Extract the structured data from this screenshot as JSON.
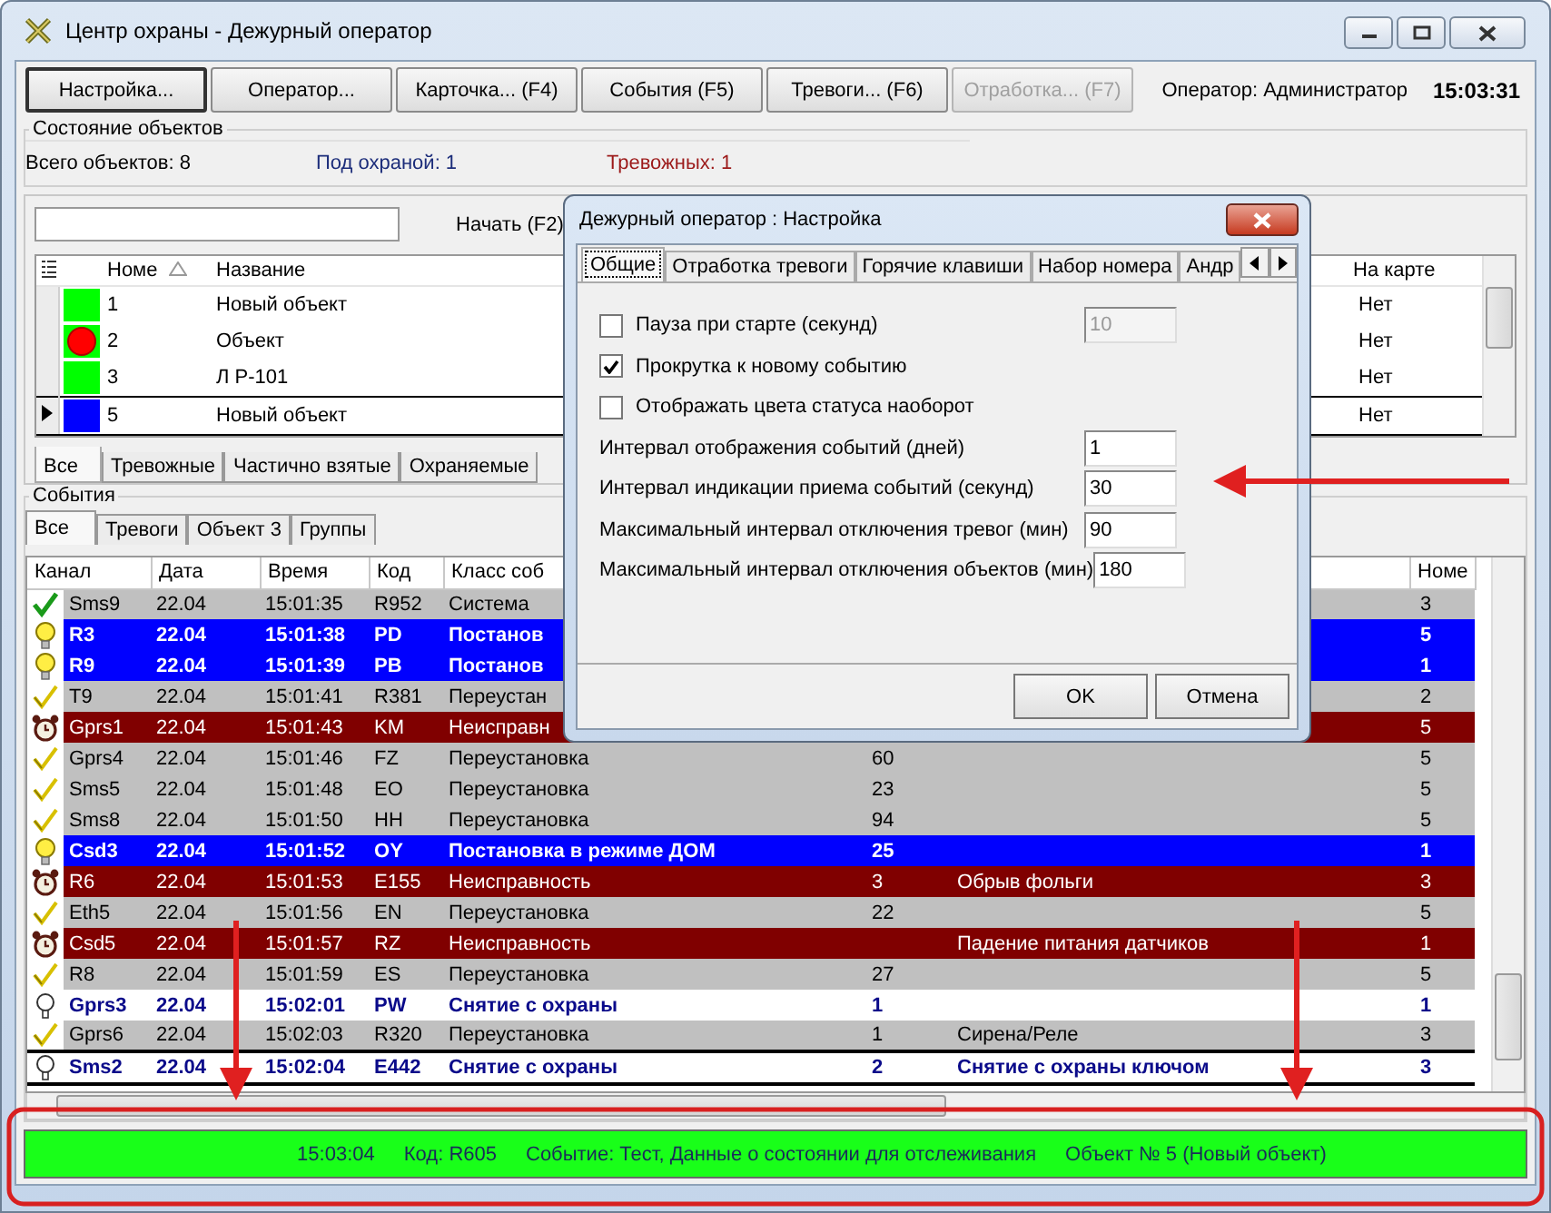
{
  "window": {
    "title": "Центр охраны - Дежурный оператор"
  },
  "toolbar": {
    "buttons": [
      {
        "label": "Настройка...",
        "default": true,
        "disabled": false
      },
      {
        "label": "Оператор...",
        "default": false,
        "disabled": false
      },
      {
        "label": "Карточка... (F4)",
        "default": false,
        "disabled": false
      },
      {
        "label": "События (F5)",
        "default": false,
        "disabled": false
      },
      {
        "label": "Тревоги... (F6)",
        "default": false,
        "disabled": false
      },
      {
        "label": "Отработка... (F7)",
        "default": false,
        "disabled": true
      }
    ],
    "operator": "Оператор: Администратор",
    "clock": "15:03:31"
  },
  "objects_state": {
    "title": "Состояние объектов",
    "counters": [
      {
        "kind": "total",
        "text": "Всего объектов: 8"
      },
      {
        "kind": "armed",
        "text": "Под охраной: 1"
      },
      {
        "kind": "alarm",
        "text": "Тревожных: 1"
      }
    ]
  },
  "objects": {
    "search_button": "Начать (F2)",
    "table": {
      "columns": [
        "Номе",
        "Название",
        "На карте"
      ],
      "rows": [
        {
          "number": "1",
          "name": "Новый объект",
          "on_map": "Нет",
          "color": "#00ff00",
          "alarm": false,
          "selected": false
        },
        {
          "number": "2",
          "name": "Объект",
          "on_map": "Нет",
          "color": "#00ff00",
          "alarm": true,
          "selected": false
        },
        {
          "number": "3",
          "name": "Л  Р-101",
          "on_map": "Нет",
          "color": "#00ff00",
          "alarm": false,
          "selected": false
        },
        {
          "number": "5",
          "name": "Новый объект",
          "on_map": "Нет",
          "color": "#0000ff",
          "alarm": false,
          "selected": true
        }
      ]
    },
    "tabs": [
      {
        "label": "Все",
        "selected": true
      },
      {
        "label": "Тревожные",
        "selected": false
      },
      {
        "label": "Частично взятые",
        "selected": false
      },
      {
        "label": "Охраняемые",
        "selected": false
      }
    ]
  },
  "events": {
    "title": "События",
    "tabs": [
      {
        "label": "Все",
        "selected": true
      },
      {
        "label": "Тревоги",
        "selected": false
      },
      {
        "label": "Объект 3",
        "selected": false
      },
      {
        "label": "Группы",
        "selected": false
      }
    ],
    "table": {
      "columns": [
        "Канал",
        "Дата",
        "Время",
        "Код",
        "Класс соб",
        "Номе"
      ],
      "rows": [
        {
          "kind": "system",
          "selected": false,
          "channel": "Sms9",
          "date": "22.04",
          "time": "15:01:35",
          "code": "R952",
          "event_class": "Система",
          "number": "3"
        },
        {
          "kind": "arm",
          "selected": false,
          "channel": "R3",
          "date": "22.04",
          "time": "15:01:38",
          "code": "PD",
          "event_class": "Постанов",
          "number": "5"
        },
        {
          "kind": "arm",
          "selected": false,
          "channel": "R9",
          "date": "22.04",
          "time": "15:01:39",
          "code": "PB",
          "event_class": "Постанов",
          "number": "1"
        },
        {
          "kind": "restore",
          "selected": false,
          "channel": "T9",
          "date": "22.04",
          "time": "15:01:41",
          "code": "R381",
          "event_class": "Переустан",
          "number": "2"
        },
        {
          "kind": "fault",
          "selected": false,
          "channel": "Gprs1",
          "date": "22.04",
          "time": "15:01:43",
          "code": "KM",
          "event_class": "Неисправн",
          "number": "5"
        },
        {
          "kind": "restore",
          "selected": false,
          "channel": "Gprs4",
          "date": "22.04",
          "time": "15:01:46",
          "code": "FZ",
          "event_class": "Переустановка",
          "column_6": "60",
          "number": "5"
        },
        {
          "kind": "restore",
          "selected": false,
          "channel": "Sms5",
          "date": "22.04",
          "time": "15:01:48",
          "code": "EO",
          "event_class": "Переустановка",
          "column_6": "23",
          "number": "5"
        },
        {
          "kind": "restore",
          "selected": false,
          "channel": "Sms8",
          "date": "22.04",
          "time": "15:01:50",
          "code": "HH",
          "event_class": "Переустановка",
          "column_6": "94",
          "number": "5"
        },
        {
          "kind": "arm",
          "selected": false,
          "channel": "Csd3",
          "date": "22.04",
          "time": "15:01:52",
          "code": "OY",
          "event_class": "Постановка в режиме ДОМ",
          "column_6": "25",
          "number": "1"
        },
        {
          "kind": "fault",
          "selected": false,
          "channel": "R6",
          "date": "22.04",
          "time": "15:01:53",
          "code": "E155",
          "event_class": "Неисправность",
          "column_6": "3",
          "column_7": "Обрыв фольги",
          "number": "3"
        },
        {
          "kind": "restore",
          "selected": false,
          "channel": "Eth5",
          "date": "22.04",
          "time": "15:01:56",
          "code": "EN",
          "event_class": "Переустановка",
          "column_6": "22",
          "number": "5"
        },
        {
          "kind": "fault",
          "selected": false,
          "channel": "Csd5",
          "date": "22.04",
          "time": "15:01:57",
          "code": "RZ",
          "event_class": "Неисправность",
          "column_7": "Падение питания датчиков",
          "number": "1"
        },
        {
          "kind": "restore",
          "selected": false,
          "channel": "R8",
          "date": "22.04",
          "time": "15:01:59",
          "code": "ES",
          "event_class": "Переустановка",
          "column_6": "27",
          "number": "5"
        },
        {
          "kind": "disarm",
          "selected": false,
          "channel": "Gprs3",
          "date": "22.04",
          "time": "15:02:01",
          "code": "PW",
          "event_class": "Снятие с охраны",
          "column_6": "1",
          "number": "1"
        },
        {
          "kind": "restore",
          "selected": false,
          "channel": "Gprs6",
          "date": "22.04",
          "time": "15:02:03",
          "code": "R320",
          "event_class": "Переустановка",
          "column_6": "1",
          "column_7": "Сирена/Реле",
          "number": "3"
        },
        {
          "kind": "disarm",
          "selected": true,
          "channel": "Sms2",
          "date": "22.04",
          "time": "15:02:04",
          "code": "E442",
          "event_class": "Снятие с охраны",
          "column_6": "2",
          "column_7": "Снятие с охраны ключом",
          "number": "3"
        }
      ]
    }
  },
  "status_bar": {
    "items": [
      "15:03:04",
      "Код: R605",
      "Событие: Тест, Данные о состоянии для отслеживания",
      "Объект № 5 (Новый объект)"
    ]
  },
  "dialog": {
    "title": "Дежурный оператор : Настройка",
    "tabs": [
      {
        "label": "Общие",
        "selected": true
      },
      {
        "label": "Отработка тревоги",
        "selected": false
      },
      {
        "label": "Горячие клавиши",
        "selected": false
      },
      {
        "label": "Набор номера",
        "selected": false
      },
      {
        "label": "Андр",
        "selected": false
      }
    ],
    "settings": [
      {
        "kind": "checkbox",
        "label": "Пауза при старте (секунд)",
        "checked": false,
        "value": "10",
        "disabled": true
      },
      {
        "kind": "checkbox",
        "label": "Прокрутка к новому событию",
        "checked": true
      },
      {
        "kind": "checkbox",
        "label": "Отображать цвета статуса наоборот",
        "checked": false
      },
      {
        "kind": "number",
        "label": "Интервал отображения событий (дней)",
        "value": "1",
        "disabled": false
      },
      {
        "kind": "number",
        "label": "Интервал индикации приема событий (секунд)",
        "value": "30",
        "disabled": false
      },
      {
        "kind": "number",
        "label": "Максимальный интервал отключения тревог (мин)",
        "value": "90",
        "disabled": false
      },
      {
        "kind": "number",
        "label": "Максимальный интервал отключения объектов (мин)",
        "value": "180",
        "disabled": false
      }
    ],
    "buttons": [
      "OK",
      "Отмена"
    ]
  }
}
